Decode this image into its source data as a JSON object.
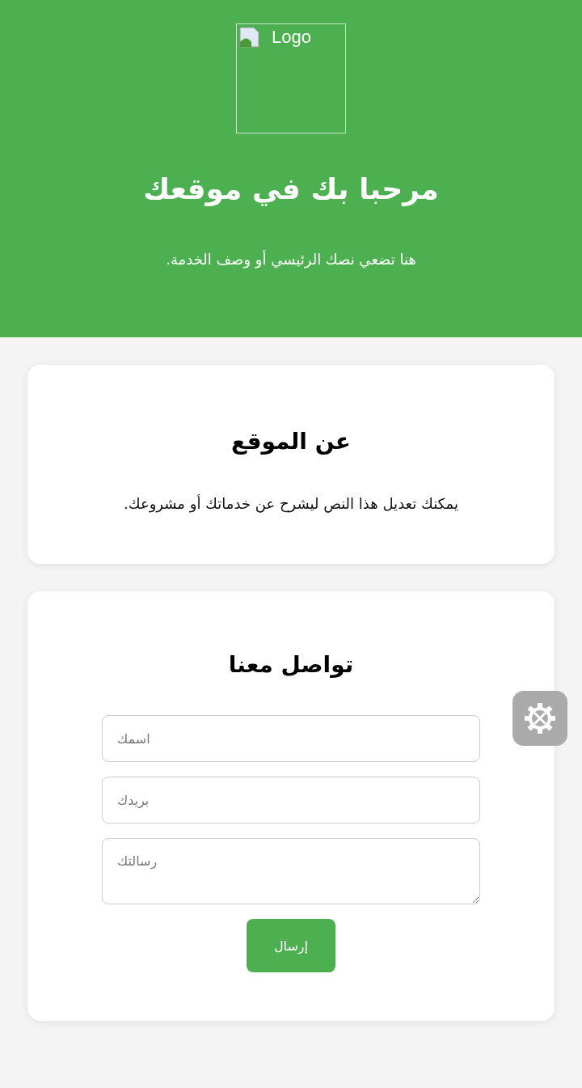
{
  "header": {
    "logo_alt": "Logo",
    "title": "مرحبا بك في موقعك",
    "subtitle": "هنا تضعي نصك الرئيسي أو وصف الخدمة."
  },
  "about": {
    "title": "عن الموقع",
    "text": "يمكنك تعديل هذا النص ليشرح عن خدماتك أو مشروعك."
  },
  "contact": {
    "title": "تواصل معنا",
    "fields": [
      {
        "kind": "input",
        "placeholder": "اسمك"
      },
      {
        "kind": "input",
        "placeholder": "بريدك"
      },
      {
        "kind": "textarea",
        "placeholder": "رسالتك"
      }
    ],
    "submit": "إرسال"
  }
}
